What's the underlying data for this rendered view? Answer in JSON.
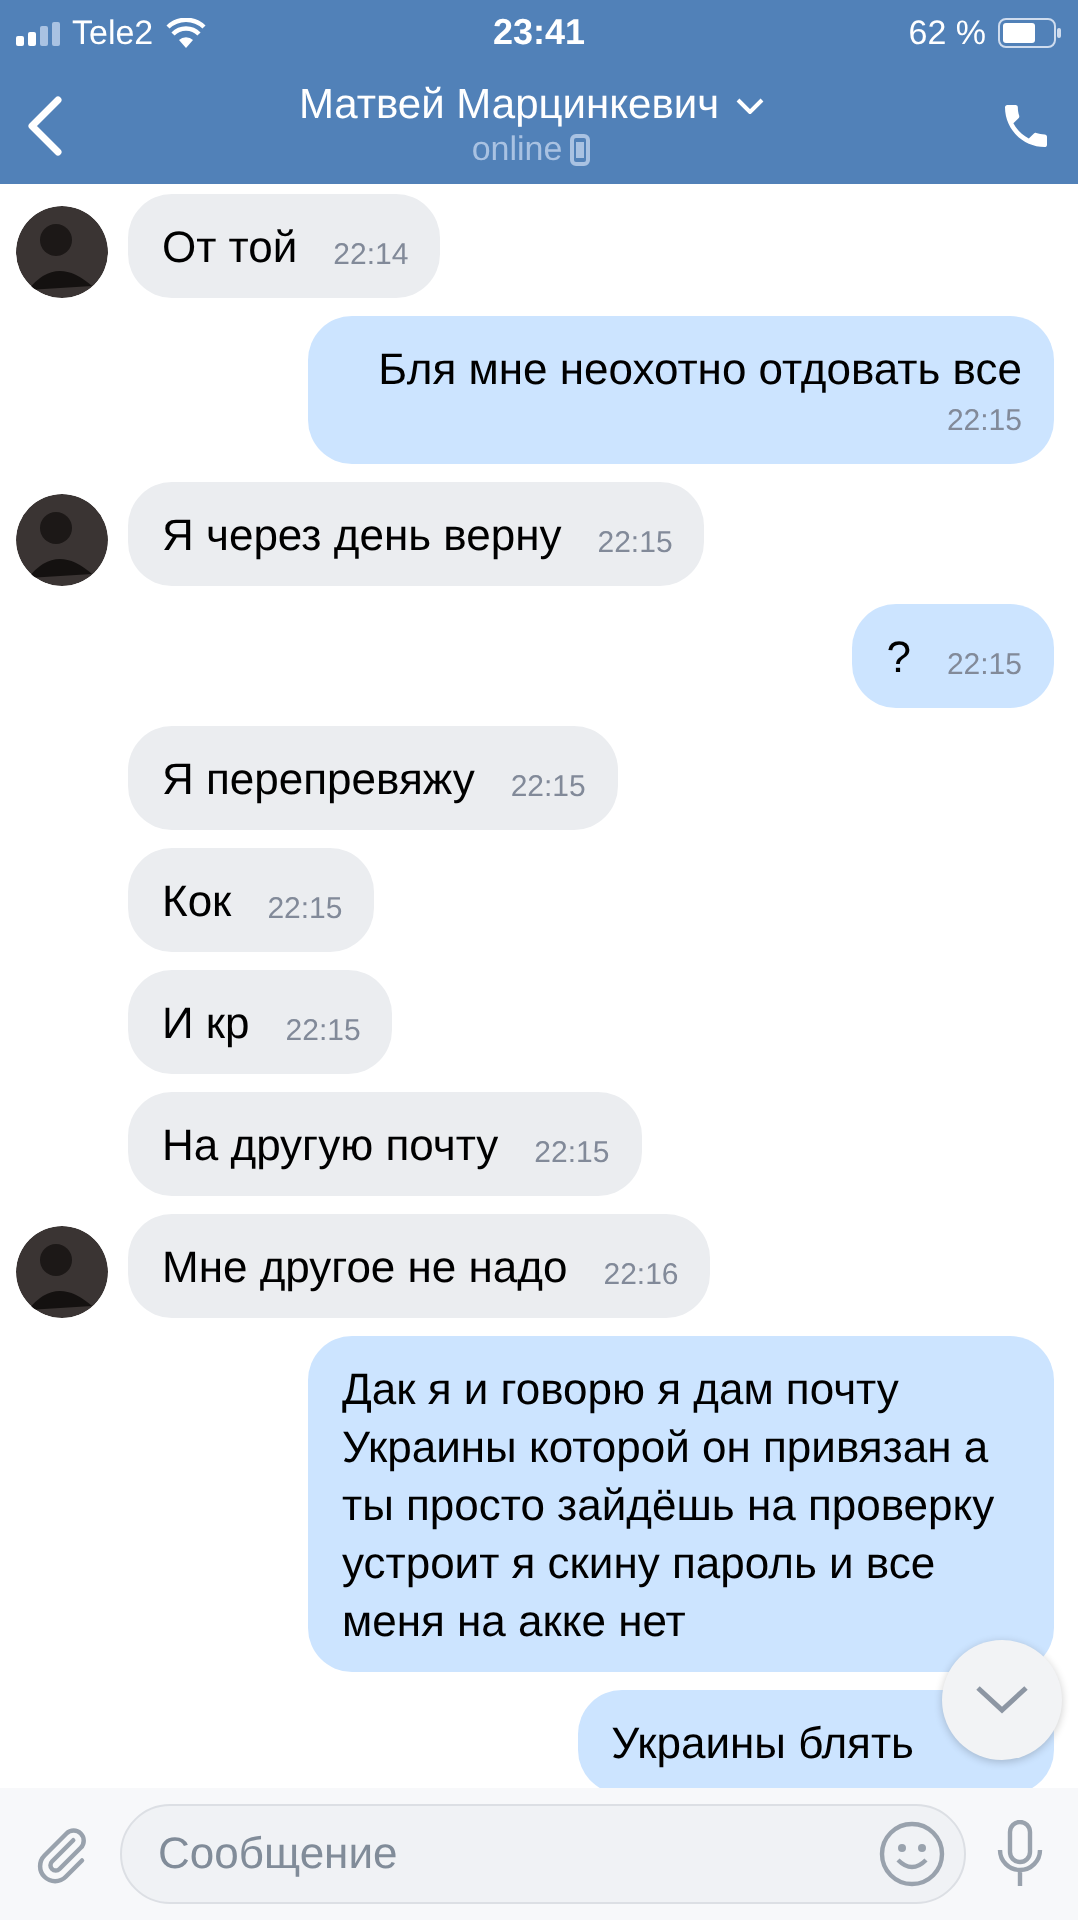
{
  "status_bar": {
    "carrier": "Tele2",
    "time": "23:41",
    "battery": "62 %"
  },
  "header": {
    "name": "Матвей Марцинкевич",
    "status": "online"
  },
  "messages": [
    {
      "kind": "incoming",
      "avatar": true,
      "text": "От той",
      "time": "22:14"
    },
    {
      "kind": "outgoing",
      "text": "Бля мне неохотно отдовать все",
      "time": "22:15"
    },
    {
      "kind": "incoming",
      "avatar": true,
      "text": "Я через день верну",
      "time": "22:15"
    },
    {
      "kind": "outgoing",
      "text": "?",
      "time": "22:15"
    },
    {
      "kind": "incoming",
      "avatar": false,
      "text": "Я перепревяжу",
      "time": "22:15"
    },
    {
      "kind": "incoming",
      "avatar": false,
      "text": "Кок",
      "time": "22:15"
    },
    {
      "kind": "incoming",
      "avatar": false,
      "text": "И кр",
      "time": "22:15"
    },
    {
      "kind": "incoming",
      "avatar": false,
      "text": "На другую почту",
      "time": "22:15"
    },
    {
      "kind": "incoming",
      "avatar": true,
      "text": "Мне другое не надо",
      "time": "22:16"
    },
    {
      "kind": "outgoing",
      "text": "Дак я и говорю я дам почту Украины которой он привязан а ты просто зайдёшь на проверку устроит я скину пароль и все меня на акке нет"
    },
    {
      "kind": "outgoing",
      "text": "Украины блять"
    }
  ],
  "composer": {
    "placeholder": "Сообщение"
  }
}
